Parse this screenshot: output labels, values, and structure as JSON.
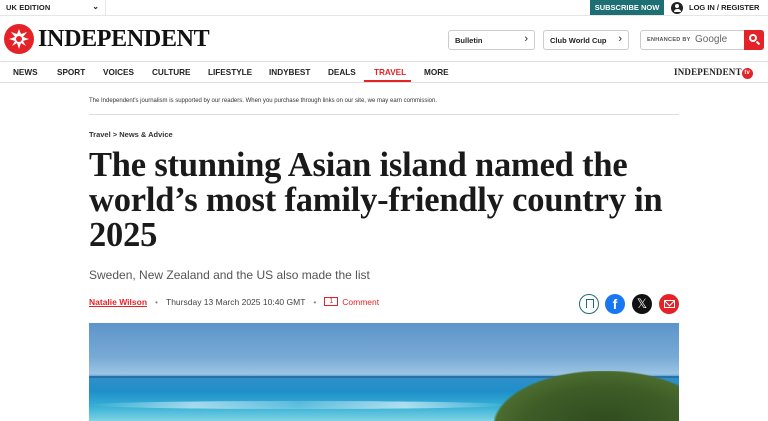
{
  "topbar": {
    "edition": "UK EDITION",
    "subscribe": "SUBSCRIBE NOW",
    "login": "LOG IN / REGISTER"
  },
  "header": {
    "logo": "INDEPENDENT",
    "bulletin": "Bulletin",
    "club_world_cup": "Club World Cup",
    "search_label": "ENHANCED BY",
    "search_brand": "Google"
  },
  "nav": {
    "items": [
      "NEWS",
      "SPORT",
      "VOICES",
      "CULTURE",
      "LIFESTYLE",
      "INDYBEST",
      "DEALS",
      "TRAVEL",
      "MORE"
    ],
    "active": "TRAVEL",
    "tv_brand": "INDEPENDENT",
    "tv_badge": "tv"
  },
  "disclaimer": "The Independent's journalism is supported by our readers. When you purchase through links on our site, we may earn commission.",
  "article": {
    "breadcrumb": "Travel > News & Advice",
    "headline": "The stunning Asian island named the world’s most family-friendly country in 2025",
    "standfirst": "Sweden, New Zealand and the US also made the list",
    "author": "Natalie Wilson",
    "date": "Thursday 13 March 2025 10:40 GMT",
    "comment_count": "1",
    "comment_label": "Comment"
  },
  "colors": {
    "brand_red": "#e42328",
    "teal": "#1e6f74",
    "facebook": "#1877f2"
  },
  "icons": [
    "chevron-down-icon",
    "user-icon",
    "eagle-logo-icon",
    "chevron-right-icon",
    "search-icon",
    "bookmark-icon",
    "facebook-icon",
    "x-icon",
    "email-icon",
    "comment-icon"
  ]
}
